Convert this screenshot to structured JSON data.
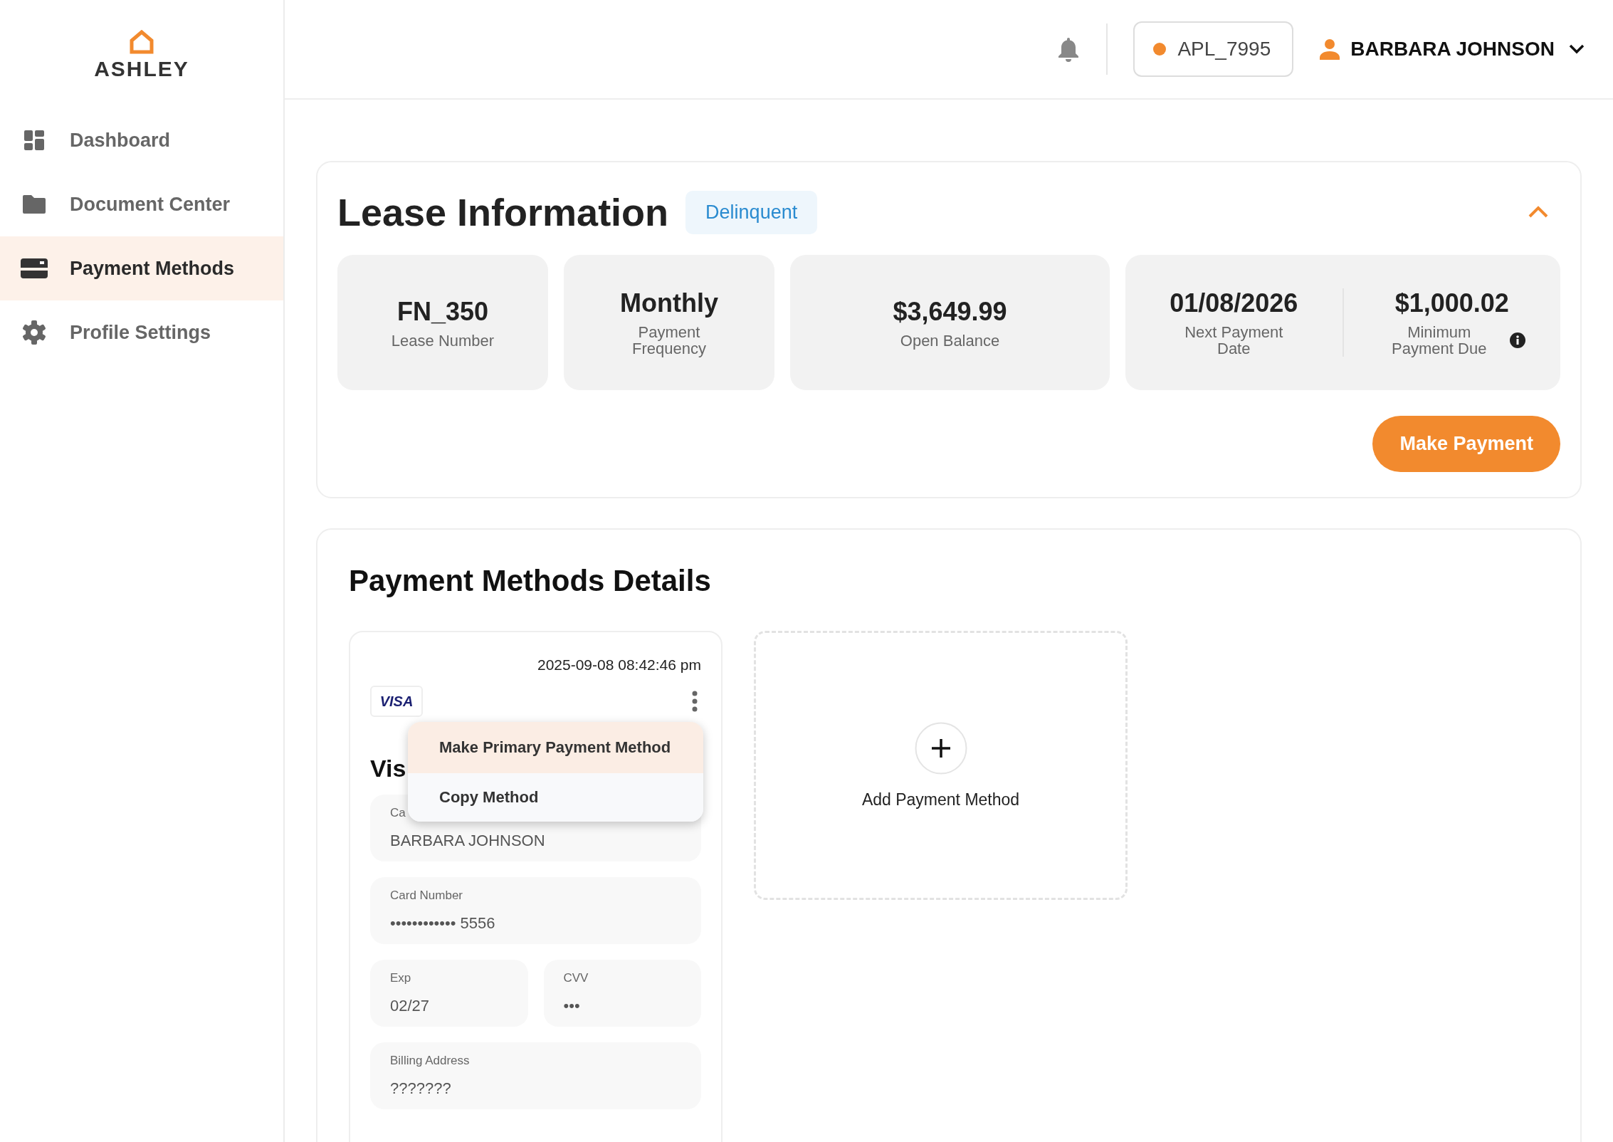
{
  "logo": {
    "text": "ASHLEY"
  },
  "sidebar": {
    "items": [
      {
        "kind": "dashboard",
        "label": "Dashboard",
        "selected": false
      },
      {
        "kind": "documents",
        "label": "Document Center",
        "selected": false
      },
      {
        "kind": "payment",
        "label": "Payment Methods",
        "selected": true
      },
      {
        "kind": "settings",
        "label": "Profile Settings",
        "selected": false
      }
    ]
  },
  "header": {
    "account": "APL_7995",
    "user": "BARBARA JOHNSON"
  },
  "lease": {
    "title": "Lease Information",
    "status": "Delinquent",
    "expanded": true,
    "tiles": [
      {
        "items": [
          {
            "value": "FN_350",
            "label": "Lease Number",
            "info": false
          }
        ]
      },
      {
        "items": [
          {
            "value": "Monthly",
            "label": "Payment Frequency",
            "info": false
          }
        ]
      },
      {
        "items": [
          {
            "value": "$3,649.99",
            "label": "Open Balance",
            "info": false
          }
        ]
      },
      {
        "items": [
          {
            "value": "01/08/2026",
            "label": "Next Payment Date",
            "info": false
          },
          {
            "value": "$1,000.02",
            "label": "Minimum Payment Due",
            "info": true
          }
        ]
      }
    ],
    "button": "Make Payment"
  },
  "payment_methods": {
    "title": "Payment Methods Details",
    "cards": [
      {
        "timestamp": "2025-09-08 08:42:46 pm",
        "brand": "VISA",
        "title": "Vis",
        "menu": [
          {
            "label": "Make Primary Payment Method",
            "selected": true
          },
          {
            "label": "Copy Method",
            "selected": false
          }
        ],
        "fields": [
          {
            "label": "Ca",
            "value": "BARBARA JOHNSON"
          },
          {
            "label": "Card Number",
            "value": "•••••••••••• 5556"
          },
          {
            "label": "Exp",
            "value": "02/27"
          },
          {
            "label": "CVV",
            "value": "•••"
          },
          {
            "label": "Billing Address",
            "value": "???????"
          }
        ]
      }
    ],
    "add": {
      "label": "Add Payment Method"
    }
  }
}
